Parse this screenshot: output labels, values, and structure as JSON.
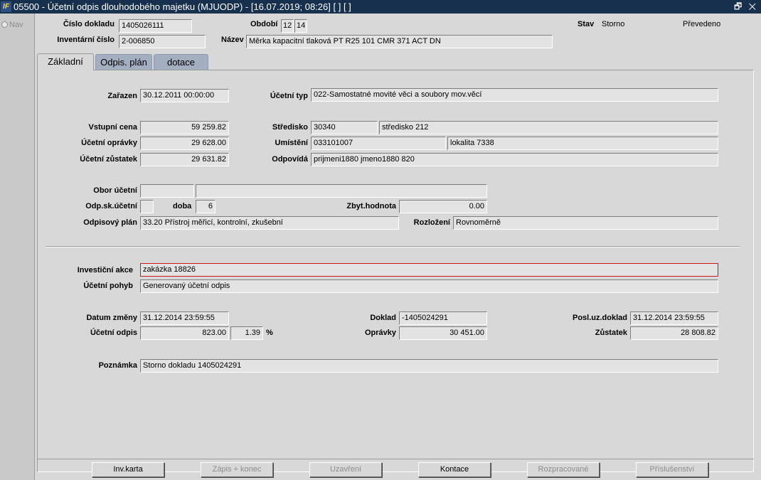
{
  "window": {
    "title": "05500 - Účetní odpis dlouhodobého majetku (MJUODP) - [16.07.2019; 08:26]  [ ]  [ ]",
    "app_icon_text": "IF",
    "window_controls": "🗗 ✕"
  },
  "nav": {
    "label": "Nav"
  },
  "header": {
    "cislo_dokladu_label": "Číslo dokladu",
    "cislo_dokladu": "1405026111",
    "obdobi_label": "Období",
    "obdobi_1": "12",
    "obdobi_2": "14",
    "stav_label": "Stav",
    "stav_value": "Storno",
    "prevedeno": "Převedeno",
    "inventarni_cislo_label": "Inventární číslo",
    "inventarni_cislo": "2-006850",
    "nazev_label": "Název",
    "nazev": "Měrka kapacitní tlaková PT R25 101 CMR 371 ACT DN"
  },
  "tabs": [
    {
      "label": "Základní",
      "active": true
    },
    {
      "label": "Odpis. plán",
      "active": false
    },
    {
      "label": "dotace",
      "active": false
    }
  ],
  "form": {
    "zarazen_label": "Zařazen",
    "zarazen": "30.12.2011 00:00:00",
    "ucetni_typ_label": "Účetní typ",
    "ucetni_typ": "022-Samostatné movité věci a soubory mov.věcí",
    "vstupni_cena_label": "Vstupní cena",
    "vstupni_cena": "59 259.82",
    "stredisko_label": "Středisko",
    "stredisko_code": "30340",
    "stredisko_name": "středisko 212",
    "ucetni_opravky_label": "Účetní oprávky",
    "ucetni_opravky": "29 628.00",
    "umisteni_label": "Umístění",
    "umisteni_code": "033101007",
    "umisteni_name": "lokalita 7338",
    "ucetni_zustatek_label": "Účetní zůstatek",
    "ucetni_zustatek": "29 631.82",
    "odpovida_label": "Odpovídá",
    "odpovida": "prijmeni1880 jmeno1880 820",
    "obor_ucetni_label": "Obor účetní",
    "obor_ucetni_code": "",
    "obor_ucetni_name": "",
    "odp_sk_label": "Odp.sk.účetní",
    "odp_sk": "",
    "doba_label": "doba",
    "doba": "6",
    "zbyt_label": "Zbyt.hodnota",
    "zbyt": "0.00",
    "odpisovy_plan_label": "Odpisový plán",
    "odpisovy_plan": "33.20 Přístroj měřicí, kontrolní, zkušební",
    "rozlozeni_label": "Rozložení",
    "rozlozeni": "Rovnoměrně",
    "investicni_akce_label": "Investiční akce",
    "investicni_akce": "zakázka 18826",
    "ucetni_pohyb_label": "Účetní pohyb",
    "ucetni_pohyb": "Generovaný účetní odpis",
    "datum_zmeny_label": "Datum změny",
    "datum_zmeny": "31.12.2014 23:59:55",
    "doklad_label": "Doklad",
    "doklad": "-1405024291",
    "posl_uz_label": "Posl.uz.doklad",
    "posl_uz": "31.12.2014 23:59:55",
    "ucetni_odpis_label": "Účetní odpis",
    "ucetni_odpis": "823.00",
    "odpis_pct": "1.39",
    "pct_sign": "%",
    "opravky_label": "Oprávky",
    "opravky": "30 451.00",
    "zustatek_label": "Zůstatek",
    "zustatek": "28 808.82",
    "poznamka_label": "Poznámka",
    "poznamka": "Storno dokladu 1405024291"
  },
  "buttons": {
    "inv_karta": "Inv.karta",
    "zapis_konec": "Zápis + konec",
    "uzavreni": "Uzavření",
    "kontace": "Kontace",
    "rozpracovane": "Rozpracované",
    "prislusenstvi": "Příslušenství"
  }
}
